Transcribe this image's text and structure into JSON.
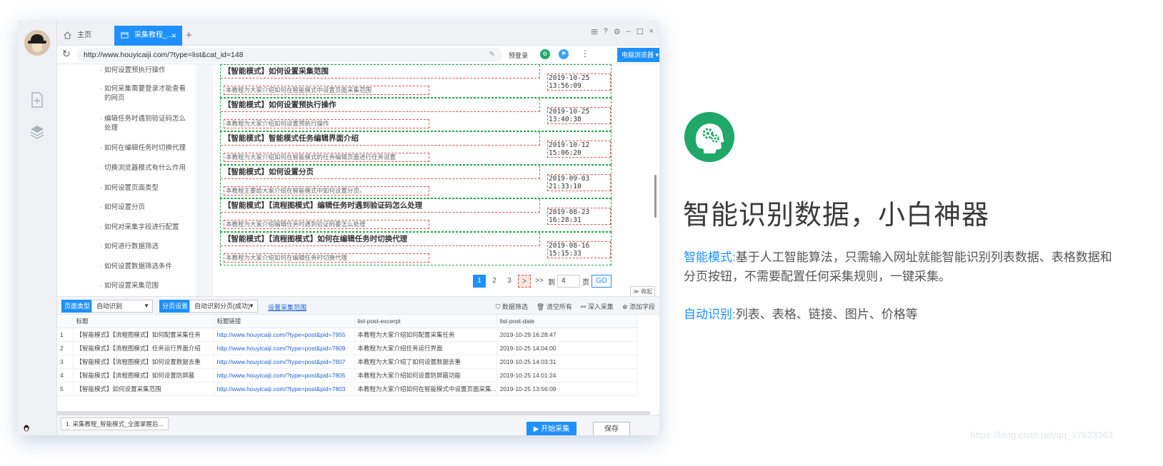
{
  "tabs": {
    "home_label": "主页",
    "active_label": "采集教程_...",
    "close_glyph": "×",
    "new_glyph": "+"
  },
  "window_controls": [
    "⊞",
    "?",
    "⚙",
    "–",
    "☐",
    "×"
  ],
  "address": {
    "url": "http://www.houyicaiji.com/?type=list&cat_id=148",
    "prelogin": "预登录",
    "browser_mode": "电脑浏览器"
  },
  "menu_items": [
    "如何设置预执行操作",
    "如何采集需要登录才能查看的网页",
    "编辑任务时遇到验证码怎么处理",
    "如何在编辑任务时切换代理",
    "切换浏览器模式有什么作用",
    "如何设置页面类型",
    "如何设置分页",
    "如何对采集字段进行配置",
    "如何进行数据筛选",
    "如何设置数据筛选条件",
    "如何设置采集范围"
  ],
  "posts": [
    {
      "title": "【智能模式】如何设置采集范围",
      "date": "2019-10-25 13:56:09",
      "excerpt": "本教程为大家介绍如何在智能模式中设置页面采集范围"
    },
    {
      "title": "【智能模式】如何设置预执行操作",
      "date": "2019-10-25 13:40:38",
      "excerpt": "本教程为大家介绍如何设置预执行操作"
    },
    {
      "title": "【智能模式】智能模式任务编辑界面介绍",
      "date": "2019-10-12 15:06:20",
      "excerpt": "本教程为大家介绍如何在智能模式的任务编辑页面进行任务设置"
    },
    {
      "title": "【智能模式】如何设置分页",
      "date": "2019-09-03 21:33:10",
      "excerpt": "本教程主要给大家介绍在智能模式中如何设置分页。"
    },
    {
      "title": "【智能模式】【流程图模式】编辑任务时遇到验证码怎么处理",
      "date": "2019-08-23 16:28:31",
      "excerpt": "本教程为大家介绍编辑任务时遇到验证码要怎么处理"
    },
    {
      "title": "【智能模式】【流程图模式】如何在编辑任务时切换代理",
      "date": "2019-08-16 15:15:33",
      "excerpt": "本教程为大家介绍如何在编辑任务时切换代理"
    }
  ],
  "pager": {
    "pages": [
      "1",
      "2",
      "3"
    ],
    "next": ">",
    "last": ">>",
    "goto_label": "到",
    "page_value": "4",
    "page_unit": "页",
    "go": "GO",
    "collapse": "收起"
  },
  "settings": {
    "page_type_label": "页面类型",
    "page_type_value": "自动识别",
    "paging_label": "分页设置",
    "paging_value": "自动识别分页(成功)",
    "range_link": "设置采集范围",
    "tools": [
      "数据筛选",
      "清空所有",
      "深入采集",
      "添加字段"
    ]
  },
  "table": {
    "columns": [
      "",
      "标题",
      "标题链接",
      "list-post-excerpt",
      "list-post-date"
    ],
    "rows": [
      [
        "1",
        "【智能模式】【流程图模式】如何配置采集任务",
        "http://www.houyicaiji.com/?type=post&pid=7955",
        "本教程为大家介绍如何配置采集任务",
        "2019-10-29 16:28:47"
      ],
      [
        "2",
        "【智能模式】【流程图模式】任务运行界面介绍",
        "http://www.houyicaiji.com/?type=post&pid=7809",
        "本教程为大家介绍任务运行界面",
        "2019-10-25 14:04:00"
      ],
      [
        "3",
        "【智能模式】【流程图模式】如何设置数据去重",
        "http://www.houyicaiji.com/?type=post&pid=7807",
        "本教程为大家介绍了如何设置数据去重",
        "2019-10-25 14:03:31"
      ],
      [
        "4",
        "【智能模式】【流程图模式】如何设置防屏蔽",
        "http://www.houyicaiji.com/?type=post&pid=7805",
        "本教程为大家介绍如何设置防屏蔽功能",
        "2019-10-25 14:01:24"
      ],
      [
        "5",
        "【智能模式】如何设置采集范围",
        "http://www.houyicaiji.com/?type=post&pid=7803",
        "本教程为大家介绍如何在智能模式中设置页面采集...",
        "2019-10-25 13:56:09"
      ]
    ]
  },
  "bottom": {
    "task_chip": "1. 采集教程_智能模式_全面掌握后...",
    "start_label": "开始采集",
    "save_label": "保存"
  },
  "promo": {
    "title": "智能识别数据，小白神器",
    "line1_key": "智能模式:",
    "line1_text": "基于人工智能算法，只需输入网址就能智能识别列表数据、表格数据和分页按钮，不需要配置任何采集规则，一键采集。",
    "line2_key": "自动识别:",
    "line2_text": "列表、表格、链接、图片、价格等",
    "accent": "#1e90ff",
    "logo_color": "#1fa868"
  },
  "watermark": "https://blog.csdn.net/qq_17623363"
}
